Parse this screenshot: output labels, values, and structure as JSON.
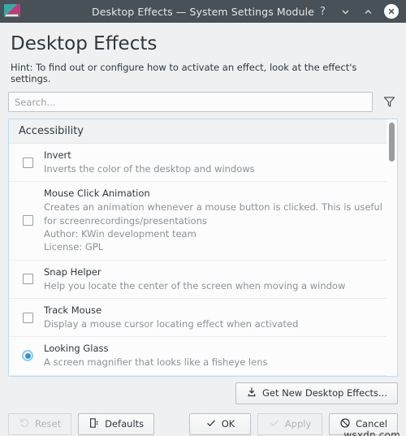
{
  "window": {
    "title": "Desktop Effects — System Settings Module",
    "app_icon": "desktop-effects-icon",
    "controls": {
      "help": "?",
      "minimize": "minimize-icon",
      "maximize": "maximize-icon",
      "close": "close-icon"
    }
  },
  "header": {
    "title": "Desktop Effects",
    "hint": "Hint: To find out or configure how to activate an effect, look at the effect's settings."
  },
  "search": {
    "placeholder": "Search...",
    "value": "",
    "filter_icon": "filter-funnel-icon"
  },
  "list": {
    "section_title": "Accessibility",
    "effects": [
      {
        "name": "Invert",
        "description": "Inverts the color of the desktop and windows",
        "control": "checkbox",
        "checked": false
      },
      {
        "name": "Mouse Click Animation",
        "description": "Creates an animation whenever a mouse button is clicked. This is useful for screenrecordings/presentations",
        "author": "Author: KWin development team",
        "license": "License: GPL",
        "control": "checkbox",
        "checked": false
      },
      {
        "name": "Snap Helper",
        "description": "Help you locate the center of the screen when moving a window",
        "control": "checkbox",
        "checked": false
      },
      {
        "name": "Track Mouse",
        "description": "Display a mouse cursor locating effect when activated",
        "control": "checkbox",
        "checked": false
      },
      {
        "name": "Looking Glass",
        "description": "A screen magnifier that looks like a fisheye lens",
        "control": "radio",
        "checked": true
      }
    ]
  },
  "footer": {
    "get_new": "Get New Desktop Effects...",
    "reset": "Reset",
    "defaults": "Defaults",
    "ok": "OK",
    "apply": "Apply",
    "cancel": "Cancel"
  },
  "watermark": "wsxdn.com",
  "colors": {
    "titlebar": "#475157",
    "accent": "#3daee9",
    "radio_fill": "#2f95cf",
    "list_border": "#b9dcee",
    "background": "#eff0f1"
  }
}
